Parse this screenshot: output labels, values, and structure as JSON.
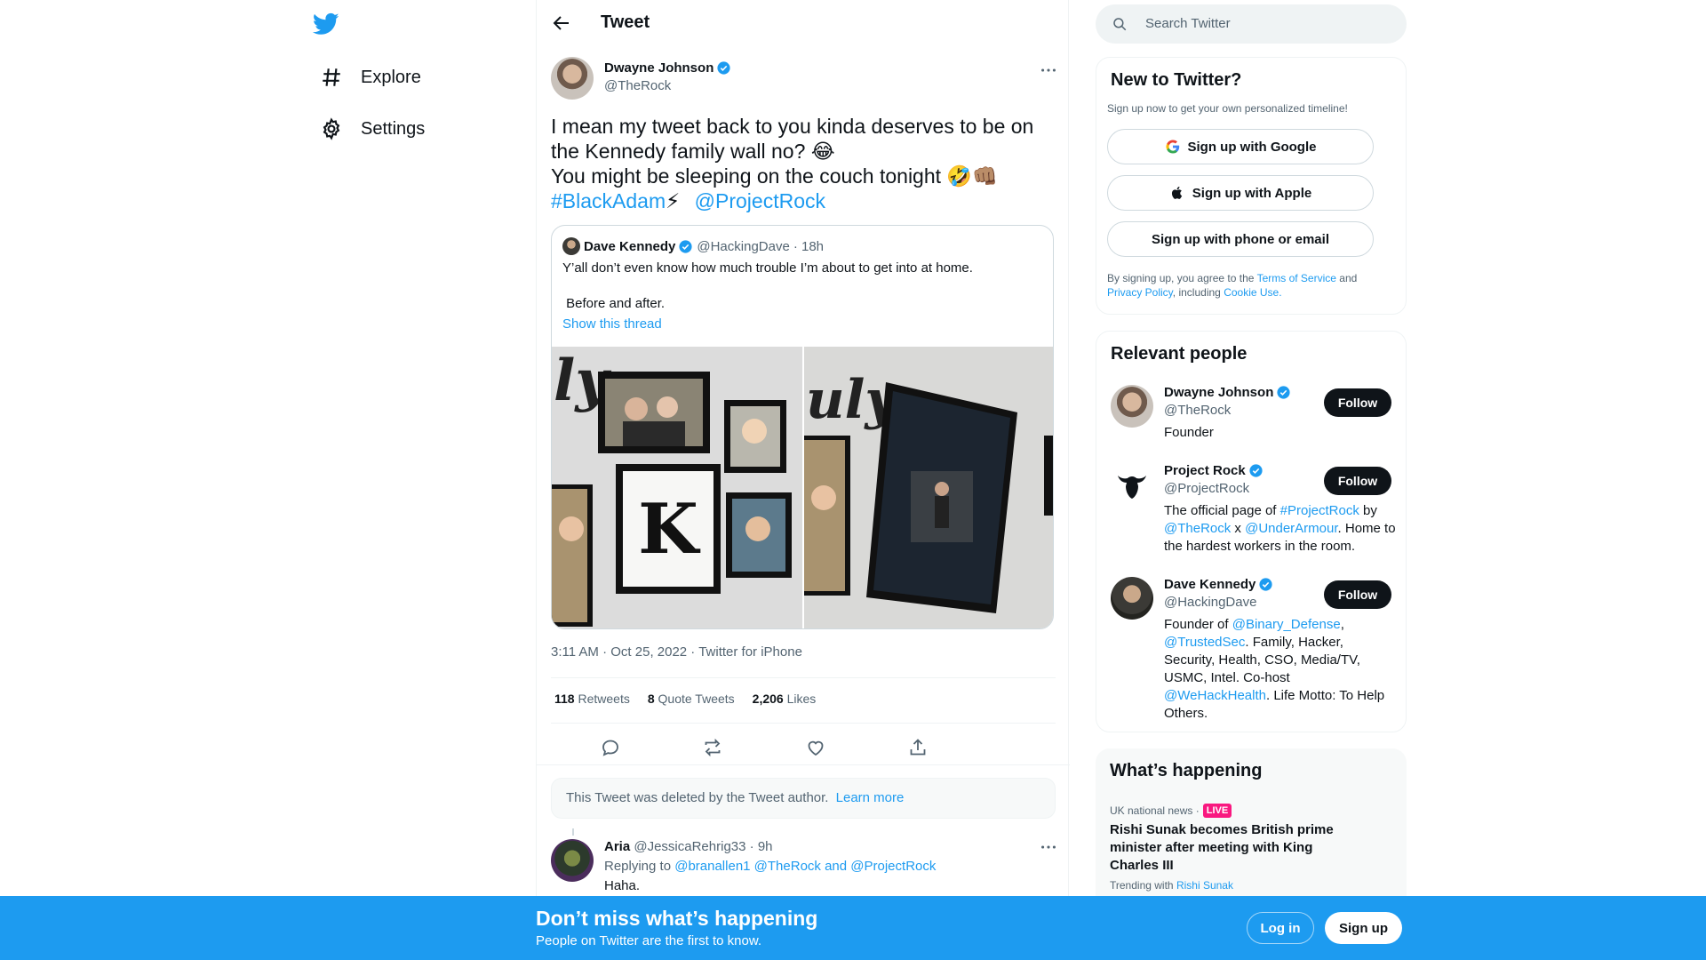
{
  "nav": {
    "explore_label": "Explore",
    "settings_label": "Settings"
  },
  "header": {
    "title": "Tweet"
  },
  "tweet": {
    "author_name": "Dwayne Johnson",
    "author_handle": "@TheRock",
    "text_line1": "I mean my tweet back to you kinda deserves to be on",
    "text_line2": "the Kennedy family wall no? 😂",
    "text_line3": "You might be sleeping on the couch tonight 🤣👊🏽",
    "hashtag": "#BlackAdam",
    "hashtag_emoji": "⚡",
    "mention": "@ProjectRock",
    "quote": {
      "author_name": "Dave Kennedy",
      "author_handle": "@HackingDave",
      "time": "· 18h",
      "text1": "Y’all don’t even know how much trouble I’m about to get into at home.",
      "text2": " Before and after.",
      "show_thread": "Show this thread",
      "img_left_monogram": "K"
    },
    "meta": "3:11 AM · Oct 25, 2022 · Twitter for iPhone",
    "stats": [
      {
        "count": "118",
        "label": "Retweets"
      },
      {
        "count": "8",
        "label": "Quote Tweets"
      },
      {
        "count": "2,206",
        "label": "Likes"
      }
    ],
    "deleted_notice": "This Tweet was deleted by the Tweet author.",
    "learn_more": "Learn more"
  },
  "reply": {
    "name": "Aria",
    "handle": "@JessicaRehrig33",
    "time": "· 9h",
    "replying_prefix": "Replying to",
    "replying_to": "@branallen1 @TheRock and @ProjectRock",
    "text": "Haha."
  },
  "search": {
    "placeholder": "Search Twitter"
  },
  "new_to_twitter": {
    "title": "New to Twitter?",
    "subtitle": "Sign up now to get your own personalized timeline!",
    "google": "Sign up with Google",
    "apple": "Sign up with Apple",
    "phone": "Sign up with phone or email",
    "legal_prefix": "By signing up, you agree to the",
    "terms": "Terms of Service",
    "and": "and",
    "privacy": "Privacy Policy",
    "including": ", including",
    "cookie": "Cookie Use."
  },
  "relevant": {
    "title": "Relevant people",
    "follow_label": "Follow",
    "people": [
      {
        "name": "Dwayne Johnson",
        "handle": "@TheRock",
        "bio": "Founder"
      },
      {
        "name": "Project Rock",
        "handle": "@ProjectRock",
        "bio_a": "The official page of ",
        "bio_tag": "#ProjectRock",
        "bio_b": " by ",
        "bio_m1": "@TheRock",
        "bio_c": " x ",
        "bio_m2": "@UnderArmour",
        "bio_d": ". Home to the hardest workers in the room."
      },
      {
        "name": "Dave Kennedy",
        "handle": "@HackingDave",
        "bio_a": "Founder of ",
        "bio_m1": "@Binary_Defense",
        "bio_b": ", ",
        "bio_m2": "@TrustedSec",
        "bio_c": ". Family, Hacker, Security, Health, CSO, Media/TV, USMC, Intel. Co-host ",
        "bio_m3": "@WeHackHealth",
        "bio_d": ". Life Motto: To Help Others."
      }
    ]
  },
  "happening": {
    "title": "What’s happening",
    "category": "UK national news ·",
    "live": "LIVE",
    "headline": "Rishi Sunak becomes British prime minister after meeting with King Charles III",
    "trending_prefix": "Trending with",
    "trending_topic": "Rishi Sunak"
  },
  "bottombar": {
    "title": "Don’t miss what’s happening",
    "subtitle": "People on Twitter are the first to know.",
    "login": "Log in",
    "signup": "Sign up"
  },
  "colors": {
    "accent": "#1d9bf0",
    "live": "#f91880",
    "text": "#0f1419",
    "muted": "#536471"
  },
  "icons": [
    "twitter-logo-icon",
    "hashtag-icon",
    "gear-icon",
    "back-arrow-icon",
    "verified-icon",
    "more-icon",
    "reply-icon",
    "retweet-icon",
    "like-icon",
    "share-icon",
    "search-icon",
    "google-icon",
    "apple-icon"
  ]
}
